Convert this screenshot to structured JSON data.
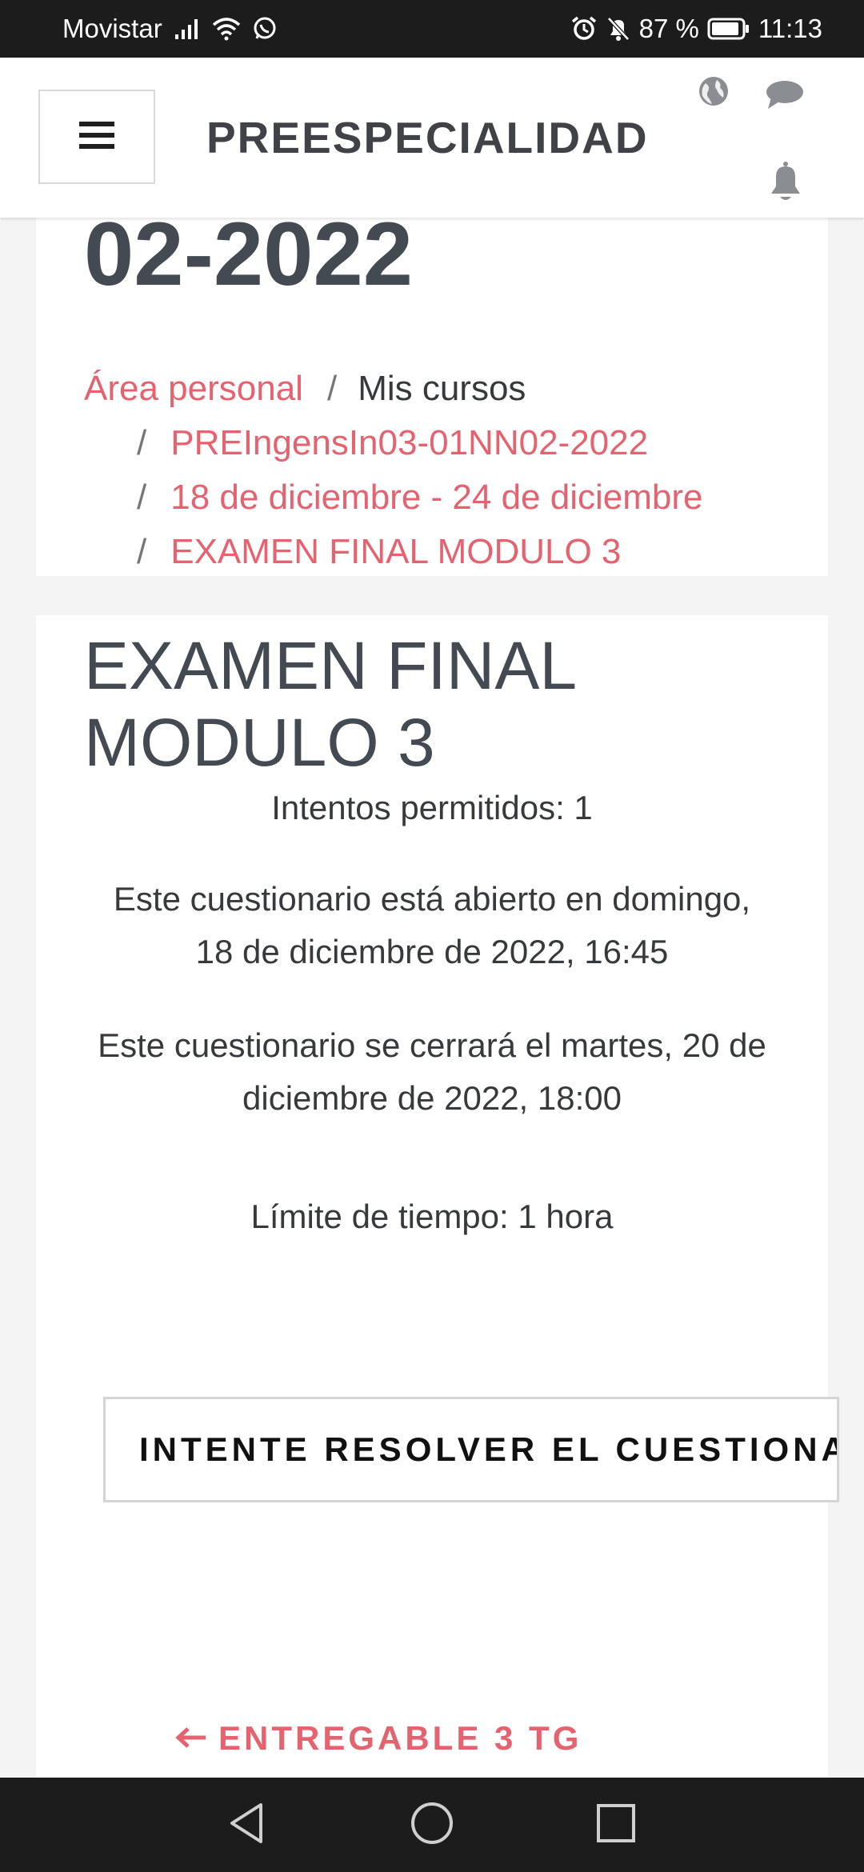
{
  "status_bar": {
    "carrier": "Movistar",
    "battery": "87 %",
    "time": "11:13",
    "icons": [
      "signal-icon",
      "wifi-icon",
      "whatsapp-icon",
      "alarm-icon",
      "mute-icon",
      "battery-icon"
    ]
  },
  "navbar": {
    "site_name": "PREESPECIALIDAD",
    "icons": [
      "menu-icon",
      "language-icon",
      "messages-icon",
      "notifications-icon"
    ]
  },
  "course_header": {
    "title_fragment": "02-2022"
  },
  "breadcrumb": {
    "items": [
      {
        "label": "Área personal",
        "link": true
      },
      {
        "label": "Mis cursos",
        "link": false
      },
      {
        "label": "PREIngensIn03-01NN02-2022",
        "link": true
      },
      {
        "label": "18 de diciembre - 24 de diciembre",
        "link": true
      },
      {
        "label": "EXAMEN FINAL MODULO 3",
        "link": true
      }
    ]
  },
  "quiz": {
    "title_line1": "EXAMEN FINAL",
    "title_line2": "MODULO 3",
    "attempts": "Intentos permitidos: 1",
    "opens_line1": "Este cuestionario está abierto en domingo,",
    "opens_line2": "18 de diciembre de 2022, 16:45",
    "closes_line1": "Este cuestionario se cerrará el martes, 20 de",
    "closes_line2": "diciembre de 2022, 18:00",
    "time_limit": "Límite de tiempo: 1 hora",
    "attempt_button": "INTENTE RESOLVER EL CUESTIONARIO AHORA"
  },
  "navigation": {
    "previous_activity": "ENTREGABLE 3 TG"
  },
  "colors": {
    "accent": "#e5626f",
    "heading": "#444a52",
    "background": "#f4f4f4",
    "bars": "#1c1c1c"
  }
}
